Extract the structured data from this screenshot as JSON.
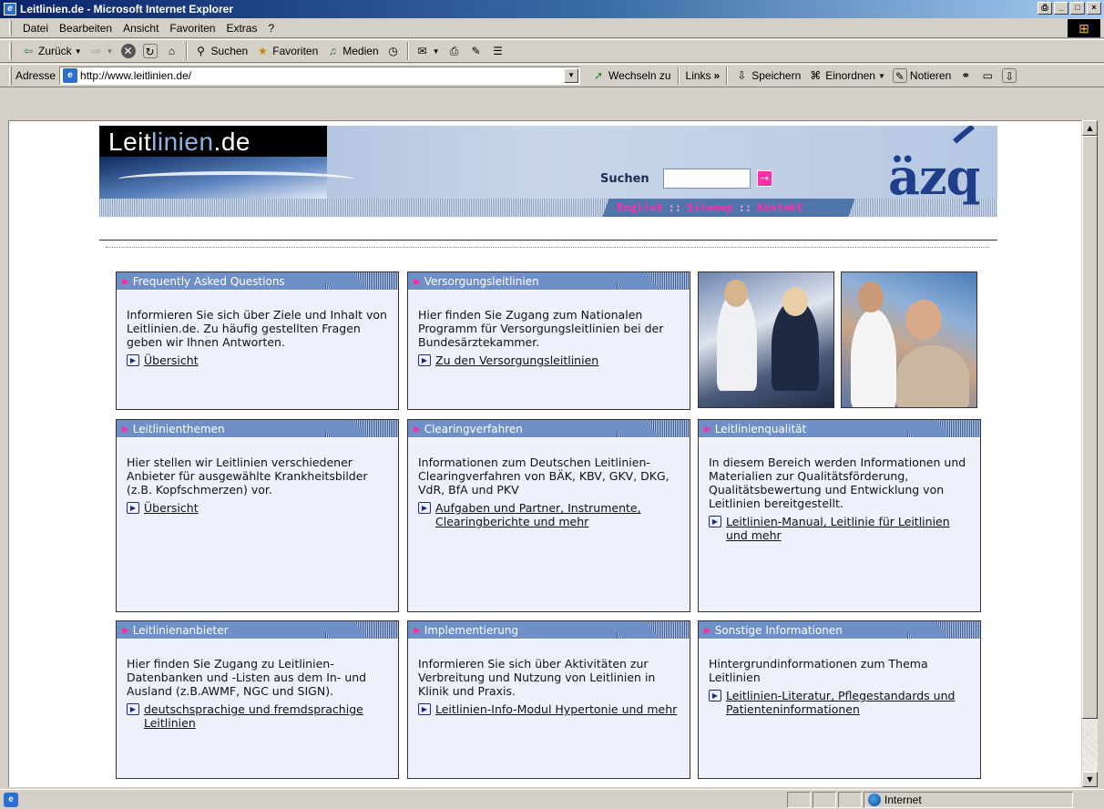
{
  "window": {
    "title": "Leitlinien.de - Microsoft Internet Explorer",
    "controls": [
      "⎙",
      "_",
      "□",
      "×"
    ]
  },
  "menu": [
    "Datei",
    "Bearbeiten",
    "Ansicht",
    "Favoriten",
    "Extras",
    "?"
  ],
  "toolbar": {
    "back": "Zurück",
    "search": "Suchen",
    "favorites": "Favoriten",
    "media": "Medien"
  },
  "address": {
    "label": "Adresse",
    "url": "http://www.leitlinien.de/",
    "go": "Wechseln zu",
    "links": "Links",
    "links_chevron": "»",
    "save": "Speichern",
    "organize": "Einordnen",
    "notes": "Notieren"
  },
  "header": {
    "logo_dark": "Leit",
    "logo_light": "linien",
    "logo_suffix": ".de",
    "search_label": "Suchen",
    "search_go": "→",
    "brand": "äzq",
    "nav": [
      "English",
      "Sitemap",
      "Kontakt"
    ],
    "nav_sep": "::"
  },
  "boxes": [
    {
      "title": "Frequently Asked Questions",
      "text": "Informieren Sie sich über Ziele und Inhalt von Leitlinien.de. Zu häufig gestellten Fragen geben wir Ihnen Antworten.",
      "link": "Übersicht"
    },
    {
      "title": "Versorgungsleitlinien",
      "text": "Hier finden Sie Zugang zum Nationalen Programm für Versorgungsleitlinien bei der Bundesärztekammer.",
      "link": "Zu den Versorgungsleitlinien"
    },
    {
      "title": "Leitlinienthemen",
      "text": "Hier stellen wir Leitlinien verschiedener Anbieter für ausgewählte Krankheitsbilder (z.B. Kopfschmerzen) vor.",
      "link": "Übersicht"
    },
    {
      "title": "Clearingverfahren",
      "text": "Informationen zum Deutschen Leitlinien-Clearingverfahren von BÄK, KBV, GKV, DKG, VdR, BfA und PKV",
      "link": "Aufgaben und Partner, Instrumente, Clearingberichte und mehr"
    },
    {
      "title": "Leitlinienqualität",
      "text": "In diesem Bereich werden Informationen und Materialien zur Qualitätsförderung, Qualitätsbewertung und Entwicklung von Leitlinien bereitgestellt.",
      "link": "Leitlinien-Manual, Leitlinie für Leitlinien und mehr"
    },
    {
      "title": "Leitlinienanbieter",
      "text": "Hier finden Sie Zugang zu Leitlinien-Datenbanken und -Listen aus dem In- und Ausland (z.B.AWMF, NGC und SIGN).",
      "link": "deutschsprachige und fremdsprachige Leitlinien"
    },
    {
      "title": "Implementierung",
      "text": "Informieren Sie sich über Aktivitäten zur Verbreitung und Nutzung von Leitlinien in Klinik und Praxis.",
      "link": "Leitlinien-Info-Modul Hypertonie und mehr"
    },
    {
      "title": "Sonstige Informationen",
      "text": "Hintergrundinformationen zum Thema Leitlinien",
      "link": "Leitlinien-Literatur, Pflegestandards und Patienteninformationen"
    }
  ],
  "status": {
    "zone": "Internet"
  },
  "colors": {
    "accent": "#ff2fa6",
    "box_head": "#6f8fc8",
    "box_bg": "#eef1fb"
  }
}
